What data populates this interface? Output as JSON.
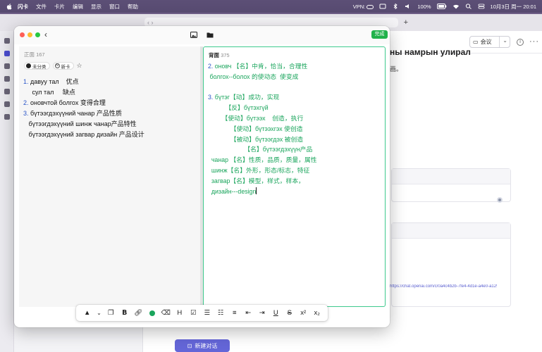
{
  "menubar": {
    "app_name": "闪卡",
    "menus": [
      "文件",
      "卡片",
      "编辑",
      "显示",
      "窗口",
      "帮助"
    ],
    "vpn": "VPN:",
    "battery": "100%",
    "datetime": "10月3日 周一 20:01"
  },
  "background_app": {
    "title": "ны намрын улирал",
    "subtitle": "画。",
    "meeting_label": "会议",
    "link_text": "https://chat.openai.com/c/0a4c4b2b-7fe4-4d1e-a4e0-a1296866120003",
    "new_chat_label": "新建对话"
  },
  "card_window": {
    "done_label": "完成",
    "front": {
      "label": "正面",
      "count": "167",
      "tag_category": "未分类",
      "tag_new": "新卡",
      "lines": [
        {
          "num": "1.",
          "text": " давуу тал    优点"
        },
        {
          "num": "",
          "text": "     сул тал     缺点"
        },
        {
          "num": "2.",
          "text": " оновчтой болгох 变得合理"
        },
        {
          "num": "3.",
          "text": " бүтээгдэхүүний чанар 产品性质"
        },
        {
          "num": "",
          "text": "   бүтээгдэхүүний шинж чанар产品特性"
        },
        {
          "num": "",
          "text": "   бүтээгдэхүүний загвар дизайн 产品设计"
        }
      ]
    },
    "back": {
      "label": "背面",
      "count": "375",
      "lines": [
        {
          "num": "2.",
          "text": " оновч 【名】中肯，恰当，合理性",
          "gap": false
        },
        {
          "num": "",
          "text": " болгох--болох 的使动态  使变成",
          "gap": false
        },
        {
          "num": "3.",
          "text": " бүтэг【动】成功，实现",
          "gap": true
        },
        {
          "num": "",
          "text": "          【反】бүтэхгүй",
          "gap": false
        },
        {
          "num": "",
          "text": "        【使动】бүтээх    创造，执行",
          "gap": false
        },
        {
          "num": "",
          "text": "             【使动】бүтээхгэх 使创造",
          "gap": false
        },
        {
          "num": "",
          "text": "             【被动】бүтээгдэх 被创造",
          "gap": false
        },
        {
          "num": "",
          "text": "                     【名】бүтээгдэхүүн产品",
          "gap": false
        },
        {
          "num": "",
          "text": "  чанар 【名】性质，品质，质量，属性",
          "gap": false
        },
        {
          "num": "",
          "text": "  шинж【名】外形，形态/标志，特征",
          "gap": false
        },
        {
          "num": "",
          "text": "  загвар【名】模型，样式，样本，",
          "gap": false
        },
        {
          "num": "",
          "text": "  дизайн---design",
          "gap": false
        }
      ]
    }
  },
  "format_toolbar": {
    "heading": "H",
    "bold": "B",
    "underline": "U",
    "strike": "S",
    "superscript": "x²",
    "subscript": "x₂",
    "accent_color": "#1aa55c"
  }
}
